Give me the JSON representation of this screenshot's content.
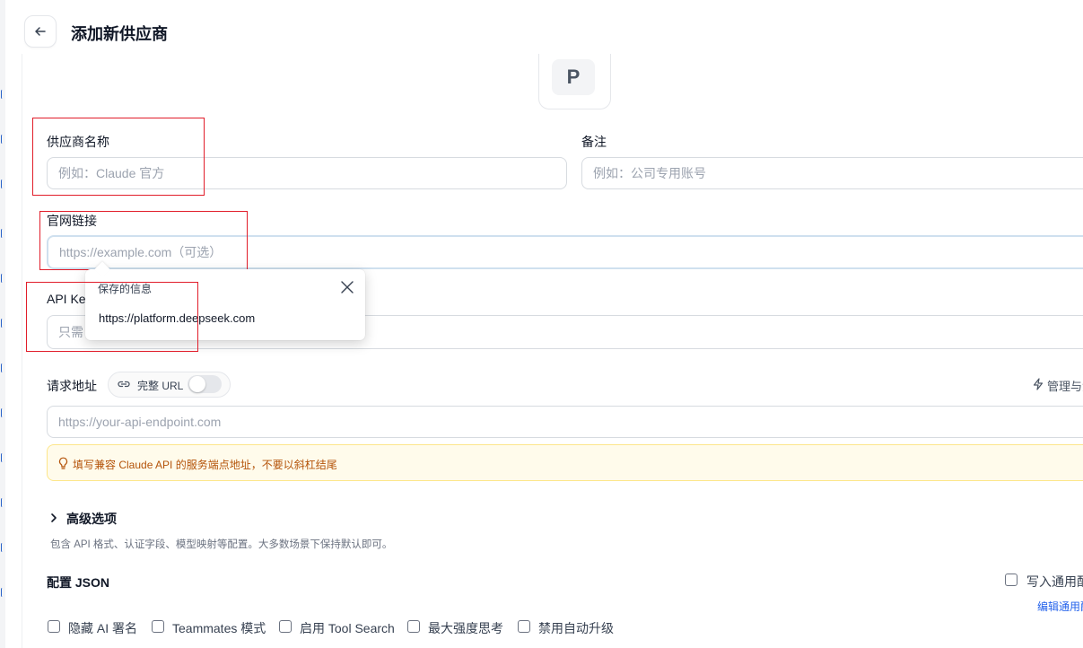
{
  "page": {
    "title": "添加新供应商",
    "avatar_letter": "P"
  },
  "form": {
    "provider_name": {
      "label": "供应商名称",
      "placeholder": "例如：Claude 官方"
    },
    "notes": {
      "label": "备注",
      "placeholder": "例如：公司专用账号"
    },
    "website": {
      "label": "官网链接",
      "placeholder": "https://example.com（可选）"
    },
    "api_key": {
      "label": "API Key",
      "placeholder": "只需"
    },
    "endpoint": {
      "label": "请求地址",
      "full_url_label": "完整 URL",
      "full_url_enabled": false,
      "manage_label": "管理与测",
      "placeholder": "https://your-api-endpoint.com",
      "hint": "填写兼容 Claude API 的服务端点地址，不要以斜杠结尾"
    },
    "advanced": {
      "label": "高级选项",
      "description": "包含 API 格式、认证字段、模型映射等配置。大多数场景下保持默认即可。"
    },
    "config_json": {
      "label": "配置 JSON",
      "write_common_label": "写入通用配",
      "edit_common_link": "编辑通用配",
      "options": [
        {
          "label": "隐藏 AI 署名",
          "checked": false
        },
        {
          "label": "Teammates 模式",
          "checked": false
        },
        {
          "label": "启用 Tool Search",
          "checked": false
        },
        {
          "label": "最大强度思考",
          "checked": false
        },
        {
          "label": "禁用自动升级",
          "checked": false
        }
      ]
    }
  },
  "autofill_popup": {
    "title": "保存的信息",
    "item": "https://platform.deepseek.com"
  },
  "colors": {
    "highlight_box": "#e11d2a",
    "hint_text": "#b45309",
    "hint_bg": "#fffbeb",
    "link": "#2563eb"
  },
  "icons": [
    "arrow-left-icon",
    "close-icon",
    "link-icon",
    "lightning-icon",
    "lightbulb-icon",
    "chevron-right-icon"
  ]
}
